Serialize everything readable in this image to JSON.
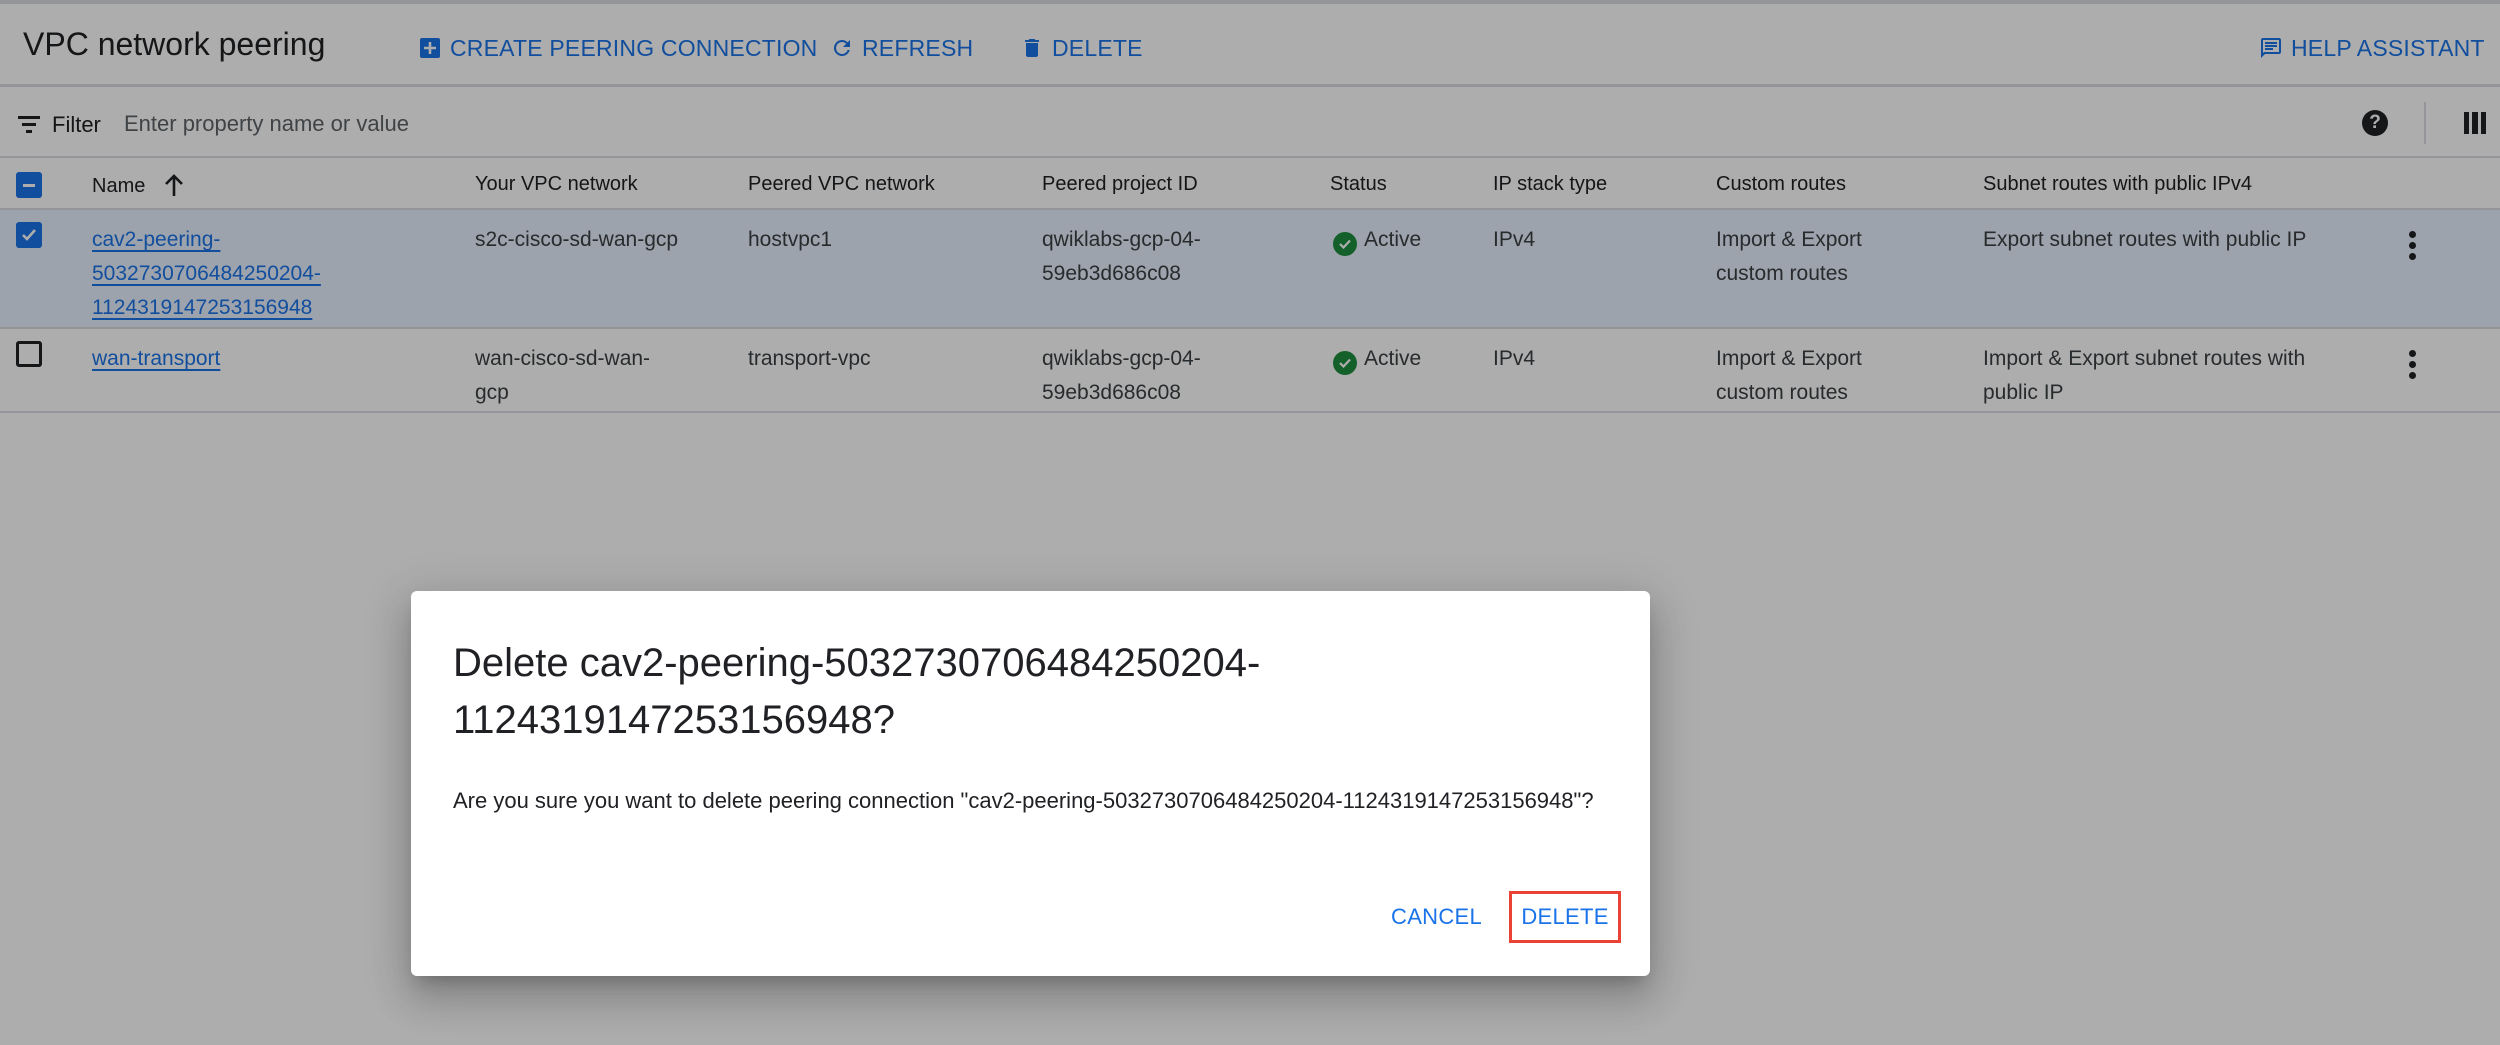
{
  "header": {
    "title": "VPC network peering",
    "actions": {
      "create": "CREATE PEERING CONNECTION",
      "refresh": "REFRESH",
      "delete": "DELETE",
      "help": "HELP ASSISTANT"
    }
  },
  "filter": {
    "label": "Filter",
    "placeholder": "Enter property name or value",
    "value": ""
  },
  "table": {
    "columns": [
      "Name",
      "Your VPC network",
      "Peered VPC network",
      "Peered project ID",
      "Status",
      "IP stack type",
      "Custom routes",
      "Subnet routes with public IPv4"
    ],
    "sort": {
      "column": "Name",
      "direction": "ascending"
    },
    "rows": [
      {
        "selected": true,
        "name_lines": [
          "cav2-peering-",
          "5032730706484250204-",
          "1124319147253156948"
        ],
        "your_vpc_lines": [
          "s2c-cisco-sd-wan-gcp"
        ],
        "peered_vpc": "hostvpc1",
        "project_lines": [
          "qwiklabs-gcp-04-",
          "59eb3d686c08"
        ],
        "status": "Active",
        "ip_stack": "IPv4",
        "custom_routes_lines": [
          "Import & Export",
          "custom routes"
        ],
        "subnet_routes_lines": [
          "Export subnet routes with public IP"
        ]
      },
      {
        "selected": false,
        "name_lines": [
          "wan-transport"
        ],
        "your_vpc_lines": [
          "wan-cisco-sd-wan-",
          "gcp"
        ],
        "peered_vpc": "transport-vpc",
        "project_lines": [
          "qwiklabs-gcp-04-",
          "59eb3d686c08"
        ],
        "status": "Active",
        "ip_stack": "IPv4",
        "custom_routes_lines": [
          "Import & Export",
          "custom routes"
        ],
        "subnet_routes_lines": [
          "Import & Export subnet routes with",
          "public IP"
        ]
      }
    ]
  },
  "dialog": {
    "title_lines": [
      "Delete cav2-peering-5032730706484250204-",
      "1124319147253156948?"
    ],
    "body": "Are you sure you want to delete peering connection \"cav2-peering-5032730706484250204-1124319147253156948\"?",
    "cancel": "CANCEL",
    "confirm": "DELETE"
  },
  "colors": {
    "accent": "#1a73e8",
    "status_ok": "#1e8e3e",
    "highlight_box": "#ea4335"
  },
  "icons": {
    "create": "add-box-icon",
    "refresh": "refresh-icon",
    "delete": "trash-icon",
    "help": "chat-feedback-icon",
    "filter": "filter-list-icon",
    "help_circle": "help-circle-icon",
    "columns": "column-display-icon",
    "sort": "arrow-up-icon",
    "status": "check-circle-icon",
    "row_menu": "more-vert-icon"
  }
}
